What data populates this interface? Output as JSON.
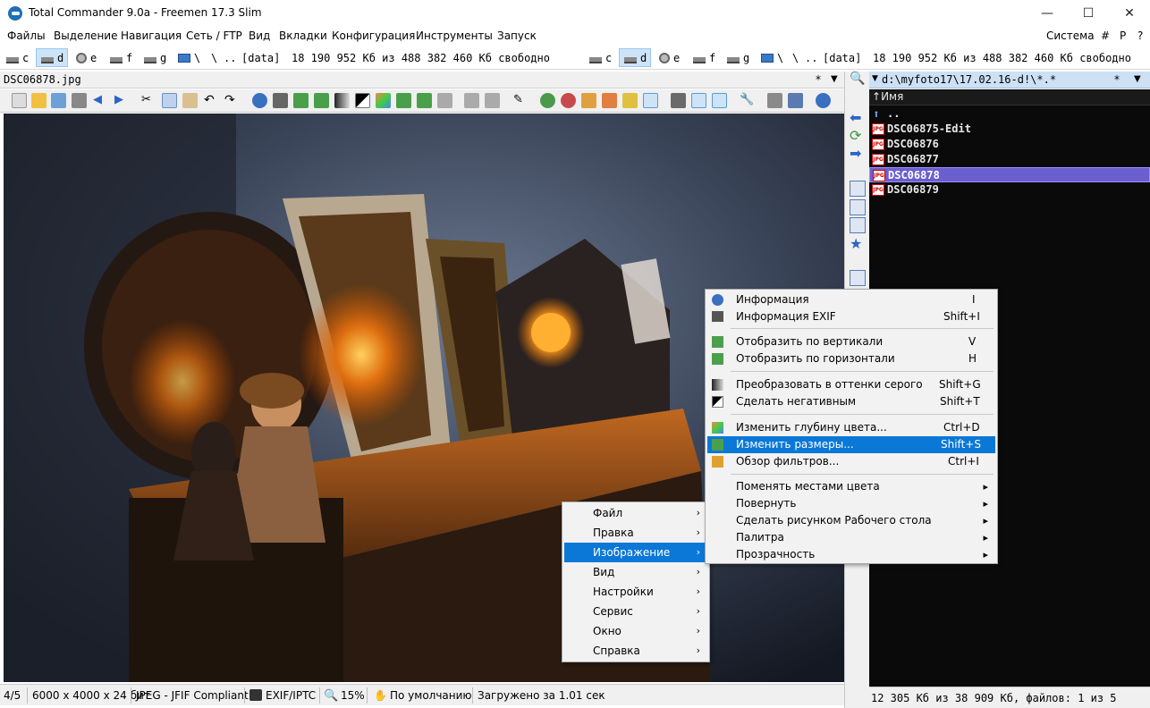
{
  "window": {
    "title": "Total Commander 9.0a - Freemen 17.3 Slim",
    "minimize": "—",
    "maximize": "☐",
    "close": "✕"
  },
  "menubar": {
    "items": [
      "Файлы",
      "Выделение",
      "Навигация",
      "Сеть / FTP",
      "Вид",
      "Вкладки",
      "Конфигурация",
      "Инструменты",
      "Запуск"
    ],
    "right": [
      "Система",
      "#",
      "P",
      "?"
    ]
  },
  "drivebar": {
    "drives": [
      "c",
      "d",
      "e",
      "f",
      "g"
    ],
    "root": "\\",
    "up": "\\",
    "dots": "..",
    "label": "[data]",
    "free": "18 190 952 Кб из 488 382 460 Кб свободно"
  },
  "viewer": {
    "filename": "DSC06878.jpg",
    "star": "*",
    "dropdown": "▼"
  },
  "status": {
    "index": "4/5",
    "size": "6000 x 4000 x 24 бит",
    "format": "JPEG - JFIF Compliant",
    "exif": "EXIF/IPTC",
    "zoom": "15%",
    "default": "По умолчанию",
    "loaded": "Загружено за 1.01 сек"
  },
  "right_panel": {
    "path": "d:\\myfoto17\\17.02.16-d!\\*.*",
    "star": "*",
    "dropdown": "▼",
    "column": "Имя",
    "updir": "..",
    "files": [
      "DSC06875-Edit",
      "DSC06876",
      "DSC06877",
      "DSC06878",
      "DSC06879"
    ],
    "selected_index": 3,
    "footer": "12 305 Кб из 38 909 Кб, файлов: 1 из 5"
  },
  "main_menu": {
    "items": [
      "Файл",
      "Правка",
      "Изображение",
      "Вид",
      "Настройки",
      "Сервис",
      "Окно",
      "Справка"
    ],
    "highlighted_index": 2
  },
  "image_menu": {
    "groups": [
      [
        {
          "label": "Информация",
          "shortcut": "I"
        },
        {
          "label": "Информация EXIF",
          "shortcut": "Shift+I"
        }
      ],
      [
        {
          "label": "Отобразить по вертикали",
          "shortcut": "V"
        },
        {
          "label": "Отобразить по горизонтали",
          "shortcut": "H"
        }
      ],
      [
        {
          "label": "Преобразовать в оттенки серого",
          "shortcut": "Shift+G"
        },
        {
          "label": "Сделать негативным",
          "shortcut": "Shift+T"
        }
      ],
      [
        {
          "label": "Изменить глубину цвета...",
          "shortcut": "Ctrl+D"
        },
        {
          "label": "Изменить размеры...",
          "shortcut": "Shift+S"
        },
        {
          "label": "Обзор фильтров...",
          "shortcut": "Ctrl+I"
        }
      ],
      [
        {
          "label": "Поменять местами цвета",
          "shortcut": ""
        },
        {
          "label": "Повернуть",
          "shortcut": ""
        },
        {
          "label": "Сделать рисунком Рабочего стола",
          "shortcut": ""
        },
        {
          "label": "Палитра",
          "shortcut": ""
        },
        {
          "label": "Прозрачность",
          "shortcut": ""
        }
      ]
    ],
    "highlighted_label": "Изменить размеры..."
  },
  "colors": {
    "accent": "#0b78d7",
    "selection": "#6b5fd0",
    "panel_bg": "#0a0a0a"
  }
}
